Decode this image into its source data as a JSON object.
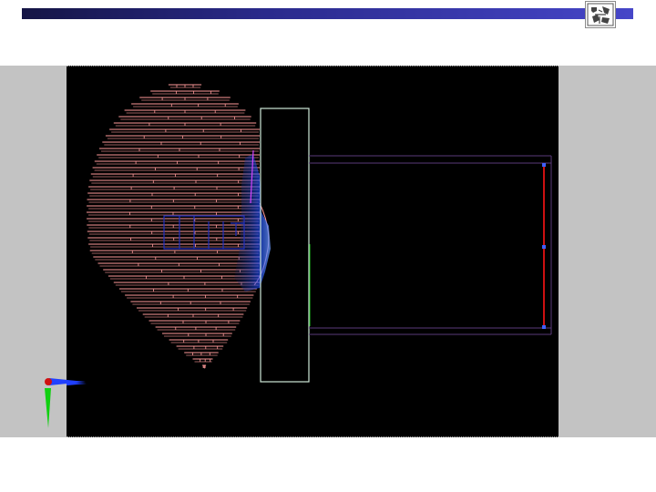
{
  "window": {},
  "logo": {
    "icon": "university-seal-icon"
  },
  "viewport": {
    "icons": {
      "axis_gizmo": "xyz-axis-gizmo-icon",
      "head_model": "head-phantom-wireframe-icon",
      "probe_model": "probe-coil-wireframe-icon"
    },
    "colors": {
      "background": "#000000",
      "head_lines": "#ff9a9a",
      "head_inner": "#2050ff",
      "plate": "#cfe8d8",
      "cylinder": "#5a3a7a",
      "end_cap": "#cc1010",
      "axis_x": "#2040ff",
      "axis_y": "#10d010",
      "axis_origin": "#d01010"
    }
  }
}
